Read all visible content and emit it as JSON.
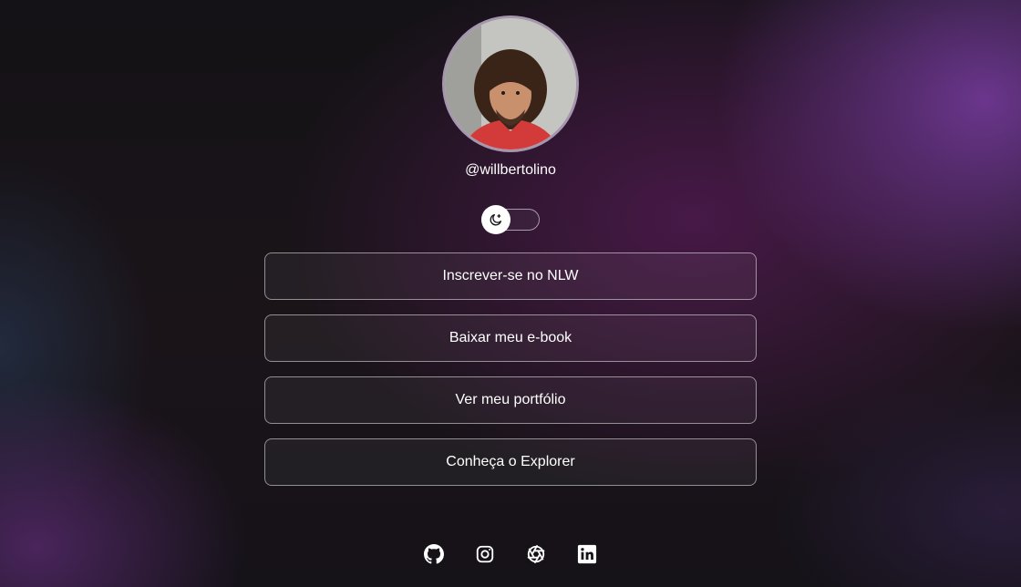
{
  "profile": {
    "username": "@willbertolino",
    "avatar_alt": "Foto de Will Bertolino"
  },
  "theme_switch": {
    "icon": "moon-stars-icon",
    "state": "dark"
  },
  "links": [
    {
      "label": "Inscrever-se no NLW"
    },
    {
      "label": "Baixar meu e-book"
    },
    {
      "label": "Ver meu portfólio"
    },
    {
      "label": "Conheça o Explorer"
    }
  ],
  "socials": [
    {
      "icon": "github-icon"
    },
    {
      "icon": "instagram-icon"
    },
    {
      "icon": "aperture-icon"
    },
    {
      "icon": "linkedin-icon"
    }
  ],
  "colors": {
    "accent": "#6b2b86",
    "text": "#ffffff",
    "avatar_border": "#a596ad"
  }
}
